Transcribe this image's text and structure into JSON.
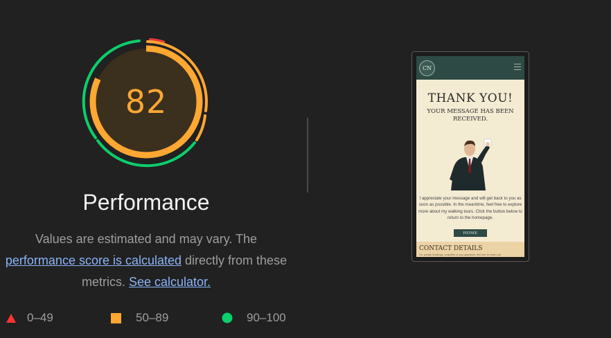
{
  "score": {
    "value": "82",
    "value_fraction": 0.82,
    "color": "#ffa733",
    "track_color": "#3b2f1e"
  },
  "category": {
    "title": "Performance"
  },
  "description": {
    "line1": "Values are estimated and may vary. The",
    "link1": "performance score is calculated",
    "line2_rest": " directly from these",
    "line3_start": "metrics. ",
    "link2": "See calculator."
  },
  "legend": {
    "fail": {
      "label": "0–49",
      "color": "#f33",
      "icon": "triangle-icon"
    },
    "average": {
      "label": "50–89",
      "color": "#ffa733",
      "icon": "square-icon"
    },
    "pass": {
      "label": "90–100",
      "color": "#0cce6b",
      "icon": "circle-icon"
    }
  },
  "screenshot": {
    "logo_text": "CN",
    "heading": "THANK YOU!",
    "subheading": "YOUR MESSAGE HAS BEEN RECEIVED.",
    "body": "I appreciate your message and will get back to you as soon as possible. In the meantime, feel free to explore more about my walking tours. Click the button below to return to the homepage.",
    "button": "HOME",
    "contact_title": "CONTACT DETAILS",
    "contact_sub": "For private bookings, enquiries or any questions, feel free to reach out"
  }
}
